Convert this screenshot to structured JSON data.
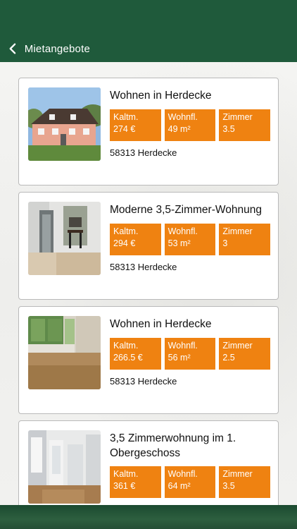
{
  "header": {
    "back_label": "Mietangebote"
  },
  "listings": [
    {
      "title": "Wohnen in Herdecke",
      "kaltm_label": "Kaltm.",
      "kaltm_value": "274 €",
      "wohnfl_label": "Wohnfl.",
      "wohnfl_value": "49 m²",
      "zimmer_label": "Zimmer",
      "zimmer_value": "3.5",
      "location": "58313 Herdecke"
    },
    {
      "title": "Moderne 3,5-Zimmer-Wohnung",
      "kaltm_label": "Kaltm.",
      "kaltm_value": "294 €",
      "wohnfl_label": "Wohnfl.",
      "wohnfl_value": "53 m²",
      "zimmer_label": "Zimmer",
      "zimmer_value": "3",
      "location": "58313 Herdecke"
    },
    {
      "title": "Wohnen in Herdecke",
      "kaltm_label": "Kaltm.",
      "kaltm_value": "266.5 €",
      "wohnfl_label": "Wohnfl.",
      "wohnfl_value": "56 m²",
      "zimmer_label": "Zimmer",
      "zimmer_value": "2.5",
      "location": "58313 Herdecke"
    },
    {
      "title": "3,5 Zimmerwohnung im 1. Obergeschoss",
      "kaltm_label": "Kaltm.",
      "kaltm_value": "361 €",
      "wohnfl_label": "Wohnfl.",
      "wohnfl_value": "64 m²",
      "zimmer_label": "Zimmer",
      "zimmer_value": "3.5",
      "location": ""
    }
  ],
  "colors": {
    "header_green": "#1f5a3b",
    "badge_orange": "#ef8211"
  },
  "icons": [
    "chevron-left-icon"
  ]
}
